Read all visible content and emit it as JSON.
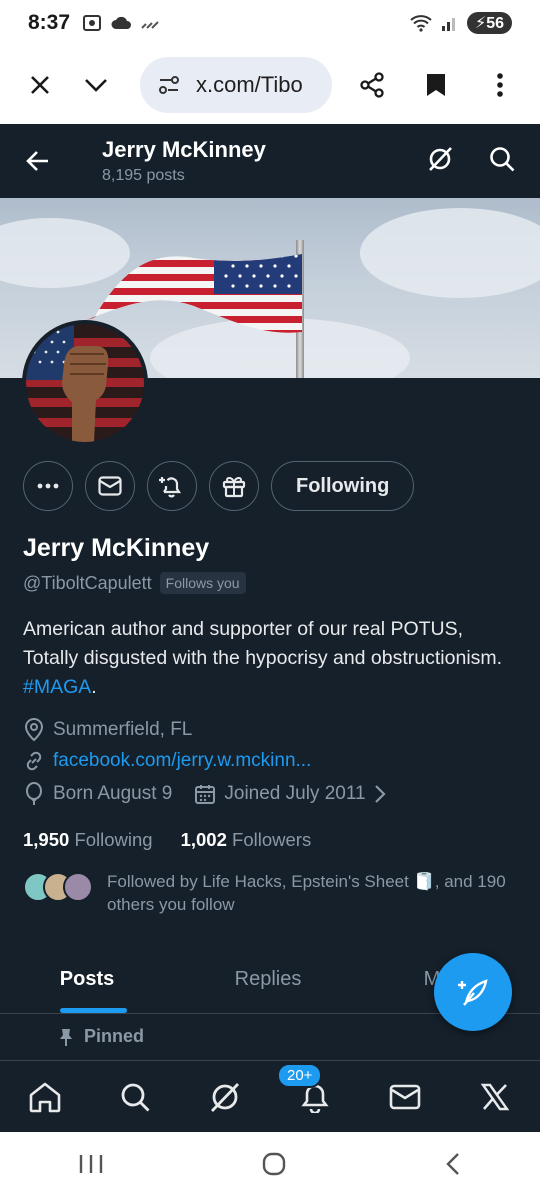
{
  "status": {
    "time": "8:37",
    "battery": "56"
  },
  "browser": {
    "url": "x.com/Tibo"
  },
  "header": {
    "name": "Jerry McKinney",
    "posts": "8,195 posts"
  },
  "actions": {
    "following_label": "Following"
  },
  "profile": {
    "name": "Jerry McKinney",
    "handle": "@TiboltCapulett",
    "follows_you": "Follows you",
    "bio_text": "American author and supporter of our real POTUS, Totally disgusted with the hypocrisy and obstructionism. ",
    "bio_hashtag": "#MAGA",
    "bio_end": ".",
    "location": "Summerfield, FL",
    "website": "facebook.com/jerry.w.mckinn...",
    "birthday": "Born August 9",
    "joined": "Joined July 2011"
  },
  "counts": {
    "following_value": "1,950",
    "following_label": "Following",
    "followers_value": "1,002",
    "followers_label": "Followers"
  },
  "followed_by": {
    "before_emoji": "Followed by Life Hacks, Epstein's Sheet ",
    "emoji": "🧻",
    "after_emoji": ", and 190 others you follow"
  },
  "tabs": [
    {
      "label": "Posts"
    },
    {
      "label": "Replies"
    },
    {
      "label": "M"
    }
  ],
  "pinned_label": "Pinned",
  "bottom_nav": {
    "notification_badge": "20+"
  },
  "colors": {
    "accent": "#1d9bf0",
    "background": "#15202b",
    "muted": "#8b98a5"
  }
}
